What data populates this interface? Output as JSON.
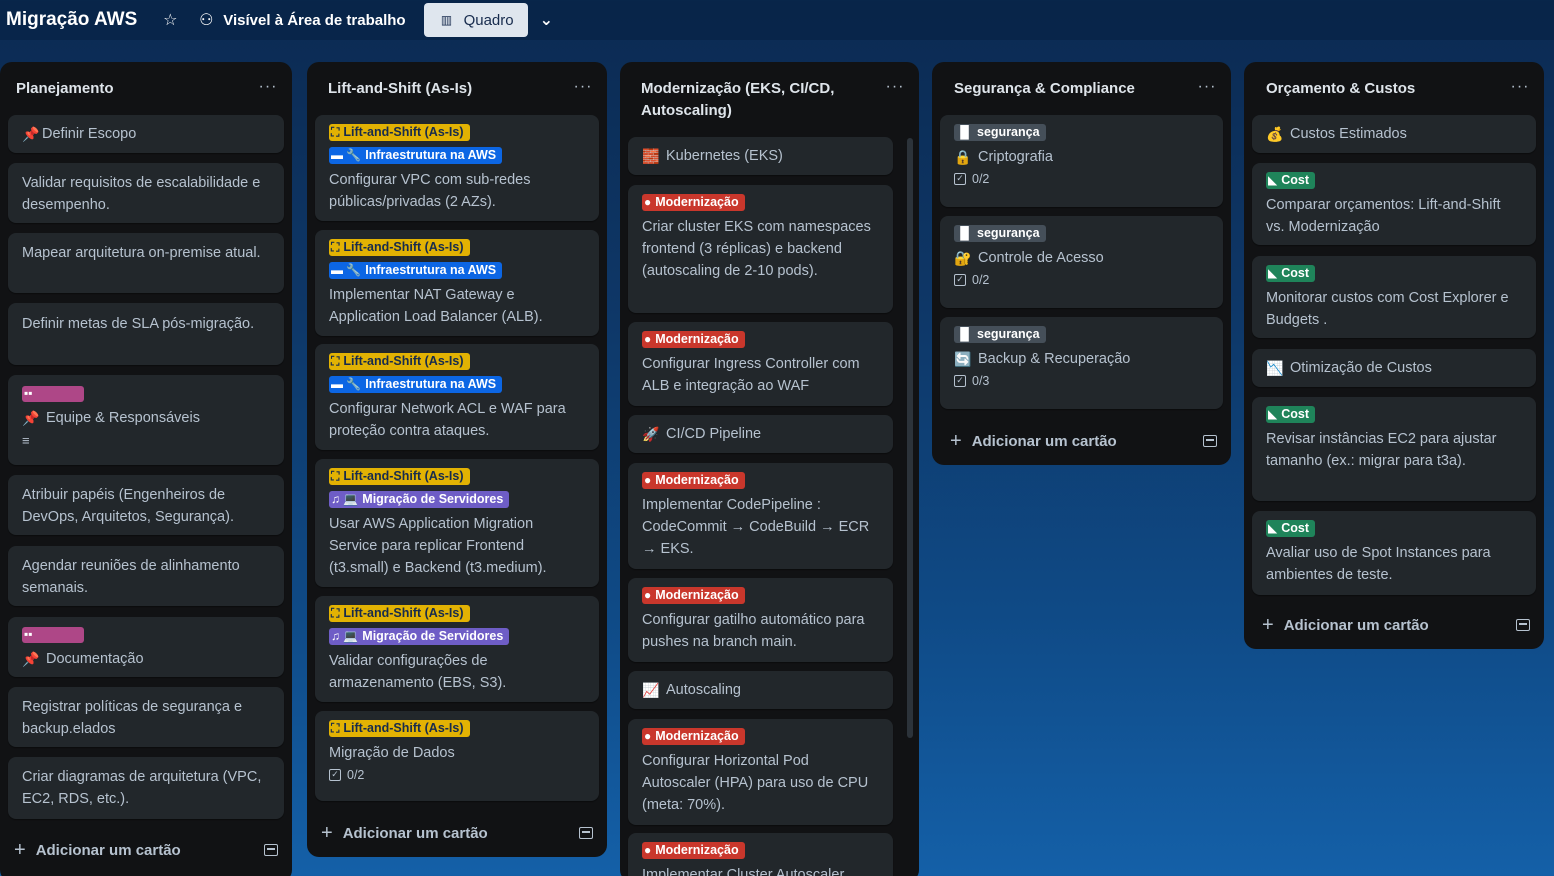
{
  "header": {
    "board_title": "Migração AWS",
    "star_icon": "☆",
    "visibility_label": "Visível à Área de trabalho",
    "visibility_icon": "⚇",
    "view_label": "Quadro",
    "view_icon": "▥",
    "chevron": "⌄"
  },
  "lists": [
    {
      "title": "Planejamento",
      "menu": "···",
      "add_label": "Adicionar um cartão",
      "cards": [
        {
          "icon": "📌",
          "text": "Definir Escopo"
        },
        {
          "text": "Validar requisitos de escalabilidade e desempenho."
        },
        {
          "text": "Mapear arquitetura on-premise atual."
        },
        {
          "text": "Definir metas de SLA pós-migração."
        },
        {
          "icon": "📌",
          "text": "Equipe & Responsáveis"
        },
        {
          "text": "Atribuir papéis (Engenheiros de DevOps, Arquitetos, Segurança)."
        },
        {
          "text": "Agendar reuniões de alinhamento semanais."
        },
        {
          "icon": "📌",
          "text": "Documentação"
        },
        {
          "text": "Registrar políticas de segurança e backup.elados"
        },
        {
          "text": "Criar diagramas de arquitetura (VPC, EC2, RDS, etc.)."
        }
      ]
    },
    {
      "title": "Lift-and-Shift (As-Is)",
      "menu": "···",
      "add_label": "Adicionar um cartão",
      "cards": [
        {
          "labels": [
            "Lift-and-Shift (As-Is)",
            "Infraestrutura na AWS"
          ],
          "text": "Configurar VPC com sub-redes públicas/privadas (2 AZs)."
        },
        {
          "labels": [
            "Lift-and-Shift (As-Is)",
            "Infraestrutura na AWS"
          ],
          "text": "Implementar NAT Gateway e Application Load Balancer (ALB)."
        },
        {
          "labels": [
            "Lift-and-Shift (As-Is)",
            "Infraestrutura na AWS"
          ],
          "text": "Configurar Network ACL e WAF para proteção contra ataques."
        },
        {
          "labels": [
            "Lift-and-Shift (As-Is)",
            "Migração de Servidores"
          ],
          "text": "Usar AWS Application Migration Service para replicar Frontend (t3.small) e Backend (t3.medium)."
        },
        {
          "labels": [
            "Lift-and-Shift (As-Is)",
            "Migração de Servidores"
          ],
          "text": "Validar configurações de armazenamento (EBS, S3)."
        },
        {
          "labels": [
            "Lift-and-Shift (As-Is)"
          ],
          "text": "Migração de Dados",
          "checklist": "0/2"
        }
      ]
    },
    {
      "title": "Modernização (EKS, CI/CD, Autoscaling)",
      "menu": "···",
      "cards": [
        {
          "icon": "🧱",
          "text": "Kubernetes (EKS)"
        },
        {
          "labels": [
            "Modernização"
          ],
          "text": "Criar cluster EKS com namespaces frontend (3 réplicas) e backend (autoscaling de 2-10 pods)."
        },
        {
          "labels": [
            "Modernização"
          ],
          "text": "Configurar Ingress Controller com ALB e integração ao WAF"
        },
        {
          "icon": "🚀",
          "text": "CI/CD Pipeline"
        },
        {
          "labels": [
            "Modernização"
          ],
          "text": "Implementar CodePipeline : CodeCommit → CodeBuild → ECR → EKS."
        },
        {
          "labels": [
            "Modernização"
          ],
          "text": "Configurar gatilho automático para pushes na branch main."
        },
        {
          "icon": "📈",
          "text": "Autoscaling"
        },
        {
          "labels": [
            "Modernização"
          ],
          "text": "Configurar Horizontal Pod Autoscaler (HPA) para uso de CPU (meta: 70%)."
        },
        {
          "labels": [
            "Modernização"
          ],
          "text": "Implementar Cluster Autoscaler"
        }
      ]
    },
    {
      "title": "Segurança & Compliance",
      "menu": "···",
      "add_label": "Adicionar um cartão",
      "cards": [
        {
          "labels": [
            "segurança"
          ],
          "icon": "🔒",
          "text": "Criptografia",
          "checklist": "0/2"
        },
        {
          "labels": [
            "segurança"
          ],
          "icon": "🔐",
          "text": "Controle de Acesso",
          "checklist": "0/2"
        },
        {
          "labels": [
            "segurança"
          ],
          "icon": "🔄",
          "text": "Backup & Recuperação",
          "checklist": "0/3"
        }
      ]
    },
    {
      "title": "Orçamento & Custos",
      "menu": "···",
      "add_label": "Adicionar um cartão",
      "cards": [
        {
          "icon": "💰",
          "text": "Custos Estimados"
        },
        {
          "labels": [
            "Cost"
          ],
          "text": "Comparar orçamentos: Lift-and-Shift vs. Modernização"
        },
        {
          "labels": [
            "Cost"
          ],
          "text": "Monitorar custos com Cost Explorer e Budgets ."
        },
        {
          "icon": "📉",
          "text": "Otimização de Custos"
        },
        {
          "labels": [
            "Cost"
          ],
          "text": "Revisar instâncias EC2 para ajustar tamanho (ex.: migrar para t3a)."
        },
        {
          "labels": [
            "Cost"
          ],
          "text": "Avaliar uso de Spot Instances para ambientes de teste."
        }
      ]
    }
  ]
}
